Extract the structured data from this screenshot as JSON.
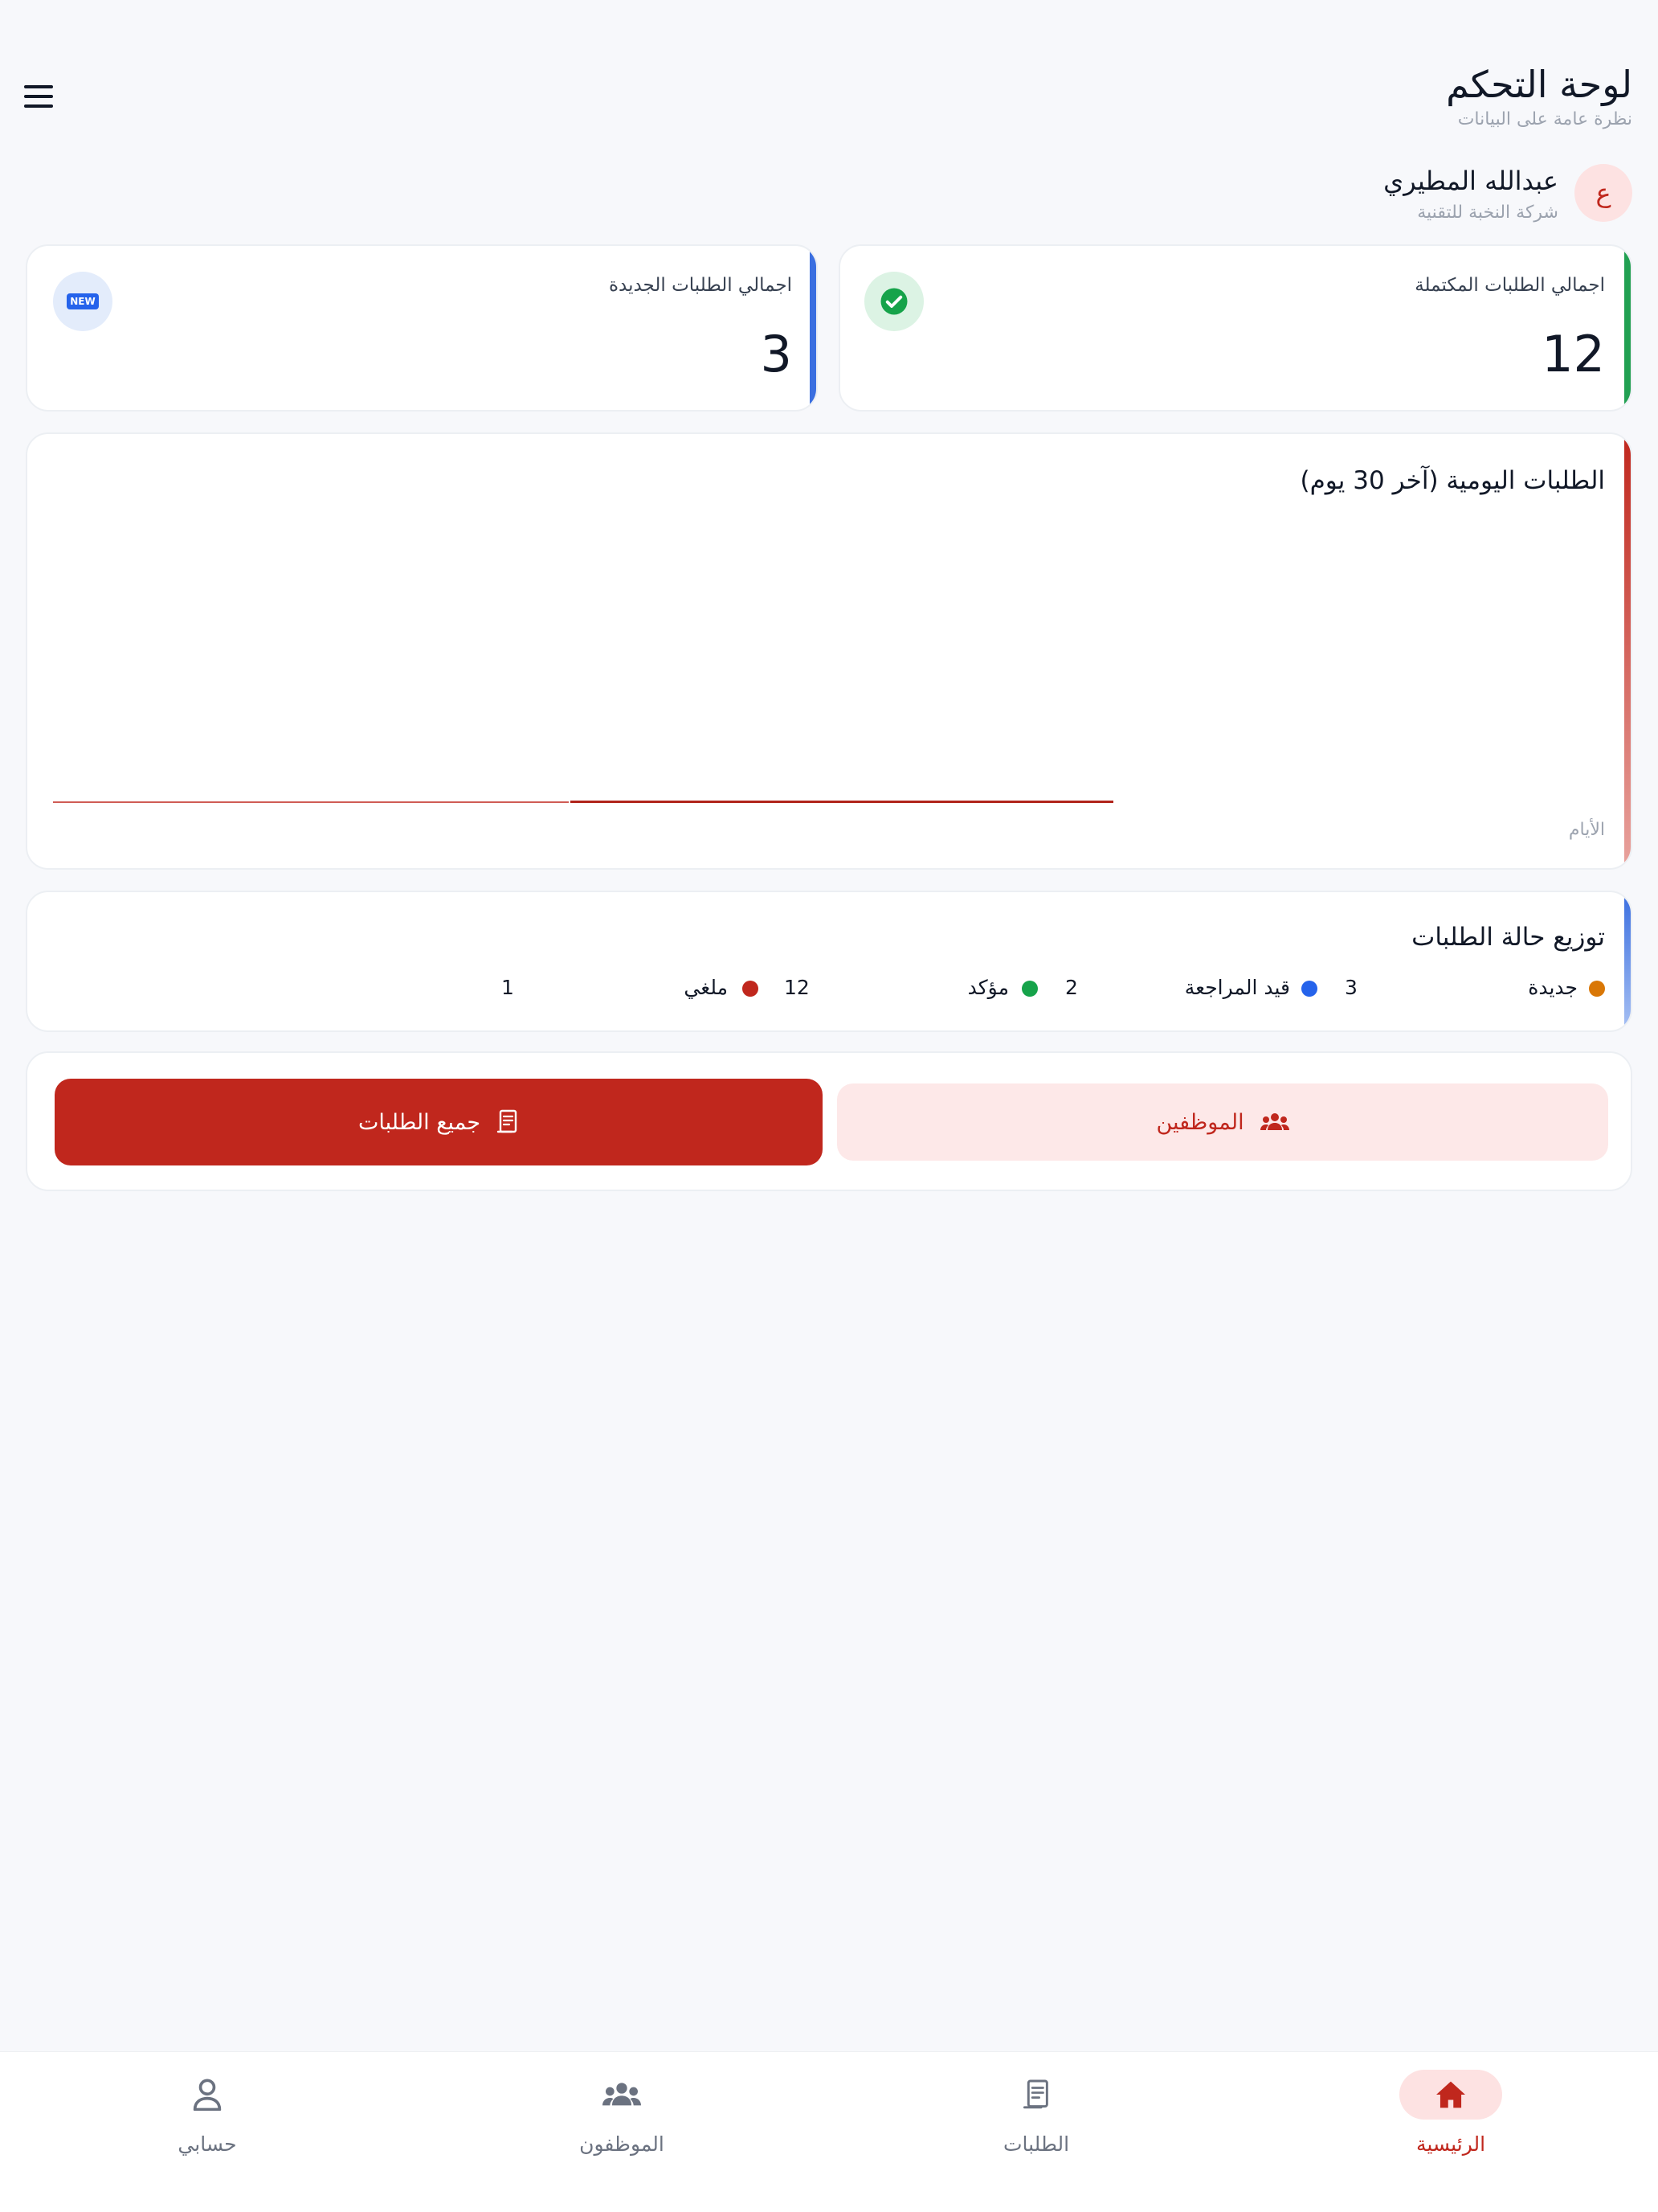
{
  "header": {
    "title": "لوحة التحكم",
    "subtitle": "نظرة عامة على البيانات",
    "menu_icon": "menu-icon"
  },
  "user": {
    "avatar_initial": "ع",
    "name": "عبدالله المطيري",
    "company": "شركة النخبة للتقنية"
  },
  "stats": {
    "completed": {
      "label": "اجمالي الطلبات المكتملة",
      "value": "12",
      "icon": "check-circle-icon",
      "accent": "#22a052"
    },
    "new": {
      "label": "اجمالي الطلبات الجديدة",
      "value": "3",
      "icon": "new-badge-icon",
      "icon_text": "NEW",
      "accent": "#3b6fe0"
    }
  },
  "daily_chart": {
    "title": "الطلبات اليومية (آخر 30 يوم)",
    "x_label": "الأيام",
    "color": "#c0271d"
  },
  "status_distribution": {
    "title": "توزيع حالة الطلبات",
    "items": [
      {
        "label": "جديدة",
        "value": "3",
        "color": "#d97706"
      },
      {
        "label": "قيد المراجعة",
        "value": "2",
        "color": "#2563eb"
      },
      {
        "label": "مؤكد",
        "value": "12",
        "color": "#16a34a"
      },
      {
        "label": "ملغي",
        "value": "1",
        "color": "#c0271d"
      }
    ]
  },
  "actions": {
    "employees_label": "الموظفين",
    "all_orders_label": "جميع الطلبات"
  },
  "bottom_nav": {
    "items": [
      {
        "label": "الرئيسية",
        "icon": "home-icon",
        "active": true
      },
      {
        "label": "الطلبات",
        "icon": "receipt-icon",
        "active": false
      },
      {
        "label": "الموظفون",
        "icon": "people-icon",
        "active": false
      },
      {
        "label": "حسابي",
        "icon": "person-icon",
        "active": false
      }
    ]
  },
  "colors": {
    "primary": "#c0271d",
    "primary_soft": "#fde8e8",
    "background": "#f7f8fb"
  }
}
